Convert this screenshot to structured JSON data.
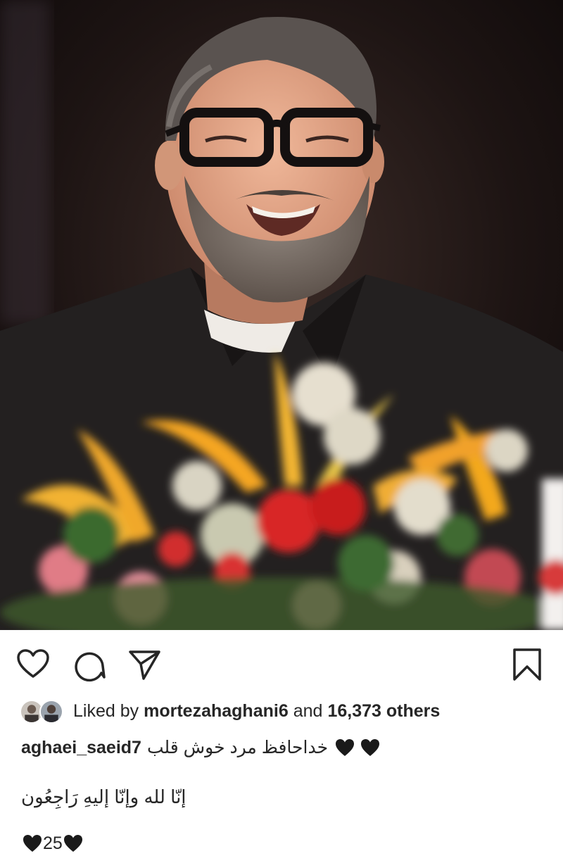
{
  "post": {
    "image_alt_subject": "smiling man with glasses and beard behind flower bouquet"
  },
  "actions": {
    "like_icon": "heart-outline-icon",
    "comment_icon": "comment-bubble-icon",
    "share_icon": "paper-plane-icon",
    "save_icon": "bookmark-icon"
  },
  "likes": {
    "prefix": "Liked by",
    "user": "mortezahaghani6",
    "joiner": "and",
    "count": "16,373 others"
  },
  "caption": {
    "username": "aghaei_saeid7",
    "text": "خداحافظ مرد خوش قلب",
    "emoji": "black-heart-icon"
  },
  "caption_line2": "إنّا لله وإنّا إليهِ رَاجِعُون",
  "caption_line3": {
    "number": "25"
  },
  "colors": {
    "text": "#262626",
    "background": "#ffffff"
  }
}
